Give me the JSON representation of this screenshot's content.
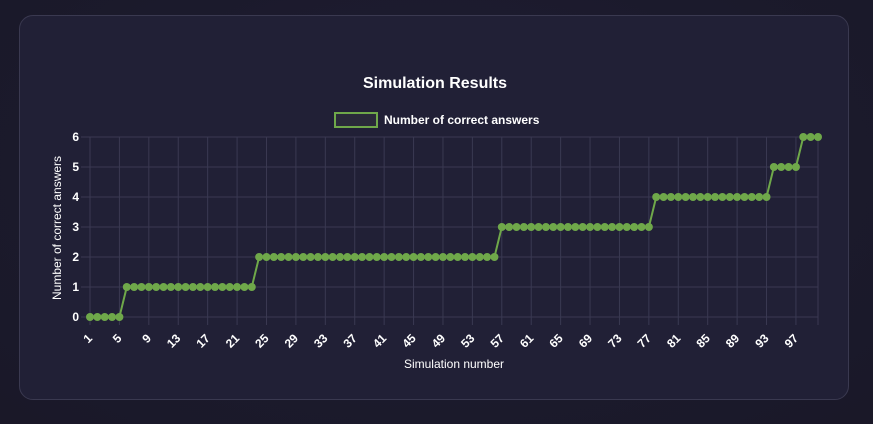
{
  "chart_data": {
    "type": "line",
    "title": "Simulation Results",
    "xlabel": "Simulation number",
    "ylabel": "Number of correct answers",
    "ylim": [
      0,
      6
    ],
    "y_ticks": [
      "0",
      "1",
      "2",
      "3",
      "4",
      "5",
      "6"
    ],
    "x_tick_labels": [
      "1",
      "5",
      "9",
      "13",
      "17",
      "21",
      "25",
      "29",
      "33",
      "37",
      "41",
      "45",
      "49",
      "53",
      "57",
      "61",
      "65",
      "69",
      "73",
      "77",
      "81",
      "85",
      "89",
      "93",
      "97"
    ],
    "legend_position": "top",
    "grid": true,
    "series": [
      {
        "name": "Number of correct answers",
        "color": "#6fa84a",
        "x": [
          1,
          2,
          3,
          4,
          5,
          6,
          7,
          8,
          9,
          10,
          11,
          12,
          13,
          14,
          15,
          16,
          17,
          18,
          19,
          20,
          21,
          22,
          23,
          24,
          25,
          26,
          27,
          28,
          29,
          30,
          31,
          32,
          33,
          34,
          35,
          36,
          37,
          38,
          39,
          40,
          41,
          42,
          43,
          44,
          45,
          46,
          47,
          48,
          49,
          50,
          51,
          52,
          53,
          54,
          55,
          56,
          57,
          58,
          59,
          60,
          61,
          62,
          63,
          64,
          65,
          66,
          67,
          68,
          69,
          70,
          71,
          72,
          73,
          74,
          75,
          76,
          77,
          78,
          79,
          80,
          81,
          82,
          83,
          84,
          85,
          86,
          87,
          88,
          89,
          90,
          91,
          92,
          93,
          94,
          95,
          96,
          97,
          98,
          99,
          100
        ],
        "values": [
          0,
          0,
          0,
          0,
          0,
          1,
          1,
          1,
          1,
          1,
          1,
          1,
          1,
          1,
          1,
          1,
          1,
          1,
          1,
          1,
          1,
          1,
          1,
          2,
          2,
          2,
          2,
          2,
          2,
          2,
          2,
          2,
          2,
          2,
          2,
          2,
          2,
          2,
          2,
          2,
          2,
          2,
          2,
          2,
          2,
          2,
          2,
          2,
          2,
          2,
          2,
          2,
          2,
          2,
          2,
          2,
          3,
          3,
          3,
          3,
          3,
          3,
          3,
          3,
          3,
          3,
          3,
          3,
          3,
          3,
          3,
          3,
          3,
          3,
          3,
          3,
          3,
          4,
          4,
          4,
          4,
          4,
          4,
          4,
          4,
          4,
          4,
          4,
          4,
          4,
          4,
          4,
          4,
          5,
          5,
          5,
          5,
          6,
          6,
          6
        ]
      }
    ]
  }
}
